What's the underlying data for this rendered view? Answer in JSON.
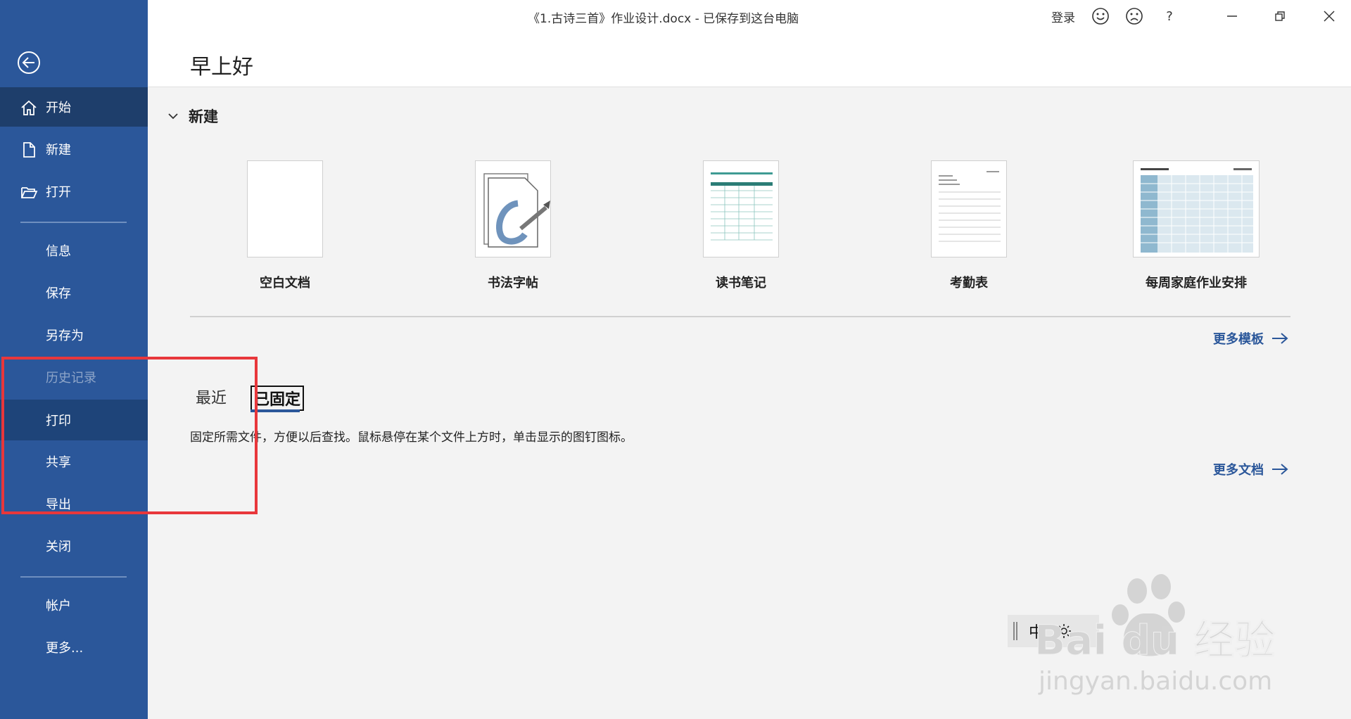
{
  "window": {
    "title": "《1.古诗三首》作业设计.docx  -  已保存到这台电脑",
    "login_label": "登录",
    "help_label": "?"
  },
  "header": {
    "greeting": "早上好"
  },
  "sidebar": {
    "items": [
      {
        "label": "开始",
        "icon": "home-icon",
        "state": "active"
      },
      {
        "label": "新建",
        "icon": "new-document-icon",
        "state": "normal"
      },
      {
        "label": "打开",
        "icon": "open-folder-icon",
        "state": "normal"
      },
      {
        "label": "信息",
        "state": "normal"
      },
      {
        "label": "保存",
        "state": "normal"
      },
      {
        "label": "另存为",
        "state": "normal"
      },
      {
        "label": "历史记录",
        "state": "disabled"
      },
      {
        "label": "打印",
        "state": "hover"
      },
      {
        "label": "共享",
        "state": "normal"
      },
      {
        "label": "导出",
        "state": "normal"
      },
      {
        "label": "关闭",
        "state": "normal"
      },
      {
        "label": "帐户",
        "state": "normal"
      },
      {
        "label": "更多...",
        "state": "normal"
      }
    ]
  },
  "new_section": {
    "title": "新建",
    "templates": [
      {
        "label": "空白文档"
      },
      {
        "label": "书法字帖"
      },
      {
        "label": "读书笔记"
      },
      {
        "label": "考勤表"
      },
      {
        "label": "每周家庭作业安排"
      }
    ],
    "more_templates_label": "更多模板"
  },
  "files_section": {
    "tabs": [
      {
        "label": "最近"
      },
      {
        "label": "已固定"
      }
    ],
    "active_tab": "已固定",
    "pinned_description": "固定所需文件，方便以后查找。鼠标悬停在某个文件上方时，单击显示的图钉图标。",
    "more_documents_label": "更多文档"
  },
  "mini_toolbar": {
    "ime_label": "中"
  },
  "watermark": {
    "brand": "Bai du 经验",
    "url": "jingyan.baidu.com"
  },
  "colors": {
    "sidebar": "#2b579a",
    "sidebar_active": "#1e3e6b",
    "accent": "#2b579a",
    "highlight_box": "#e8373b"
  }
}
